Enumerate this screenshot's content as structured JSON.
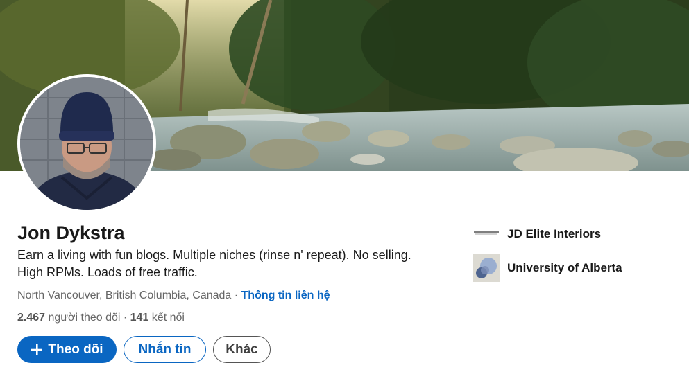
{
  "profile": {
    "name": "Jon Dykstra",
    "headline": "Earn a living with fun blogs. Multiple niches (rinse n' repeat). No selling. High RPMs. Loads of free traffic.",
    "location": "North Vancouver, British Columbia, Canada",
    "separator": " · ",
    "contact_info_label": "Thông tin liên hệ",
    "followers_count": "2.467",
    "followers_label": " người theo dõi",
    "connections_separator": " · ",
    "connections_count": "141",
    "connections_label": " kết nối"
  },
  "actions": {
    "follow_label": "Theo dõi",
    "follow_icon": "plus-icon",
    "message_label": "Nhắn tin",
    "more_label": "Khác"
  },
  "organizations": [
    {
      "name": "JD Elite Interiors",
      "logo": "jd-elite-interiors-logo"
    },
    {
      "name": "University of Alberta",
      "logo": "university-of-alberta-logo"
    }
  ],
  "colors": {
    "primary": "#0a66c2",
    "text": "#191919",
    "muted": "#666666"
  }
}
